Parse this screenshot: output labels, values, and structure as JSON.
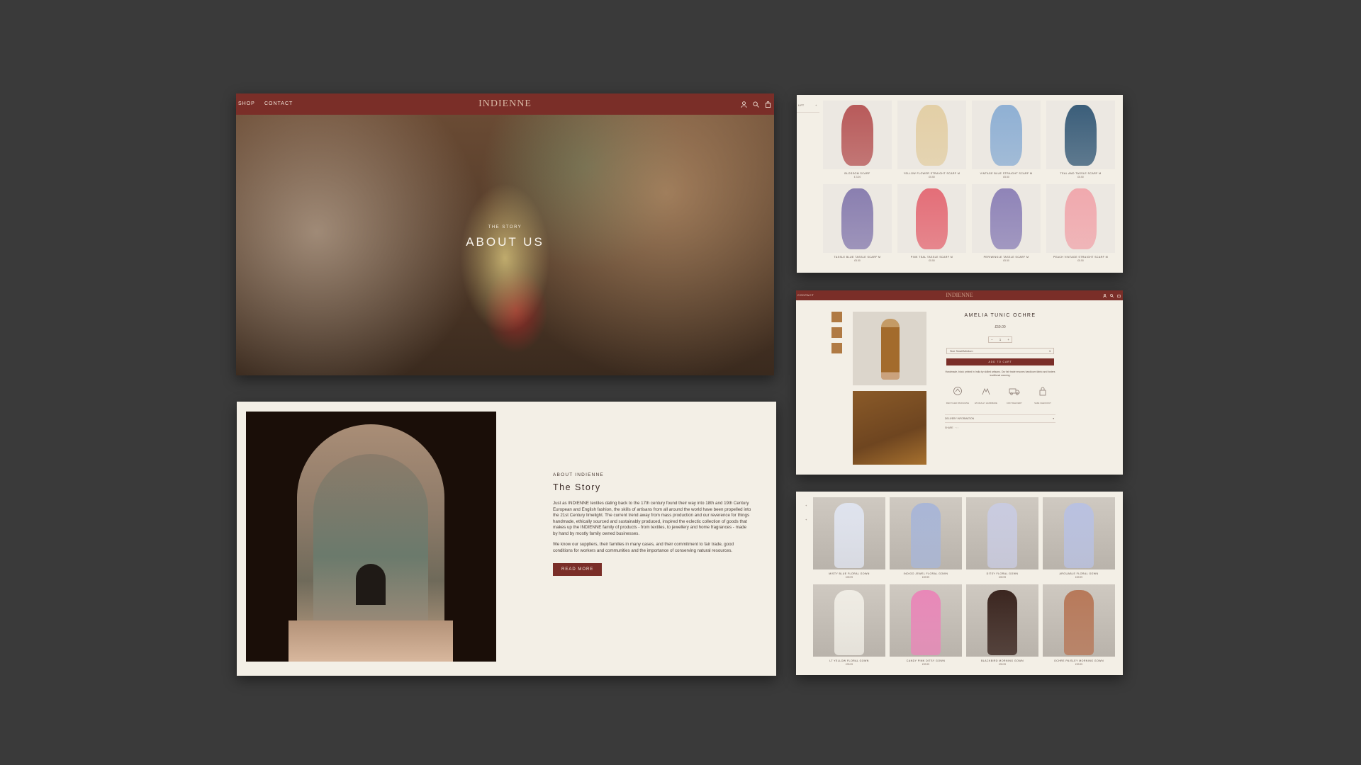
{
  "hero": {
    "nav": [
      "SHOP",
      "CONTACT"
    ],
    "logo": "INDIENNE",
    "kicker": "THE STORY",
    "title": "ABOUT US"
  },
  "story": {
    "kicker": "ABOUT INDIENNE",
    "title": "The Story",
    "paragraphs": [
      "Just as INDIENNE textiles dating back to the 17th century found their way into 18th and 19th Century European and English fashion, the skills of artisans from all around the world have been propelled into the 21st Century limelight. The current trend away from mass production and our reverence for things handmade, ethically sourced and sustainably produced, inspired the eclectic collection of goods that makes up the INDIENNE family of products - from textiles, to jewellery and home fragrances - made by hand by mostly family owned businesses.",
      "We know our suppliers, their families in many cases, and their commitment to fair trade, good conditions for workers and communities and the importance of conserving natural resources."
    ],
    "button": "READ MORE"
  },
  "scarves": {
    "side": [
      "LIFT",
      "+"
    ],
    "items": [
      {
        "name": "BLOSSOM SCARF",
        "price": "£ 3.00",
        "color": "#b85a5a"
      },
      {
        "name": "YELLOW FLOWER STRAIGHT SCARF M",
        "price": "£5.50",
        "color": "#e3cfa6"
      },
      {
        "name": "VINTAGE BLUE STRAIGHT SCARF M",
        "price": "£5.50",
        "color": "#8fb0d4"
      },
      {
        "name": "TEAL AND TASSLE SCARF M",
        "price": "£5.50",
        "color": "#3b5e7a"
      },
      {
        "name": "TASSLE BLUE TASSLE SCARF M",
        "price": "£5.50",
        "color": "#8a7fb0"
      },
      {
        "name": "PINK TEAL TASSLE SCARF M",
        "price": "£5.50",
        "color": "#e46e78"
      },
      {
        "name": "PERIWINKLE TASSLE SCARF M",
        "price": "£5.50",
        "color": "#8f84b8"
      },
      {
        "name": "PEACH VINTAGE STRAIGHT SCARF M",
        "price": "£5.50",
        "color": "#f0a9ae"
      }
    ]
  },
  "product": {
    "nav": "CONTACT",
    "logo": "INDIENNE",
    "title": "AMELIA TUNIC OCHRE",
    "price": "£59.00",
    "qty": "1",
    "select": "Size Small/Medium",
    "cart": "ADD TO CART",
    "desc": "Handmade, block printed in India by skilled artisans. Our fair trade ensures handloom fabric and fosters traditional weaving.",
    "features": [
      "RECYCLED PACKAGING",
      "ETHICALLY HANDMADE",
      "FAST DELIVERY",
      "SAFE CHECKOUT"
    ],
    "accordion": "DELIVERY INFORMATION",
    "share": "SHARE"
  },
  "gowns": {
    "side": [
      "+",
      "+"
    ],
    "items": [
      {
        "name": "MISTY BLUE FLORAL GOWN",
        "price": "£39.99",
        "color": "#dfe3ee"
      },
      {
        "name": "INDIGO JEWEL FLORAL GOWN",
        "price": "£39.99",
        "color": "#a9b6d6"
      },
      {
        "name": "DITSY FLORAL GOWN",
        "price": "£39.99",
        "color": "#c9cbe0"
      },
      {
        "name": "ARGUABLE FLORAL GOWN",
        "price": "£39.99",
        "color": "#b9c1e0"
      },
      {
        "name": "LT YELLOW FLORAL GOWN",
        "price": "£39.99",
        "color": "#efece4"
      },
      {
        "name": "CANDY PINK DITSY GOWN",
        "price": "£39.99",
        "color": "#e888b8"
      },
      {
        "name": "BLACKBIRD MORNING GOWN",
        "price": "£39.99",
        "color": "#3b2620"
      },
      {
        "name": "OCHRE PAISLEY MORNING GOWN",
        "price": "£39.99",
        "color": "#b7795a"
      }
    ]
  }
}
